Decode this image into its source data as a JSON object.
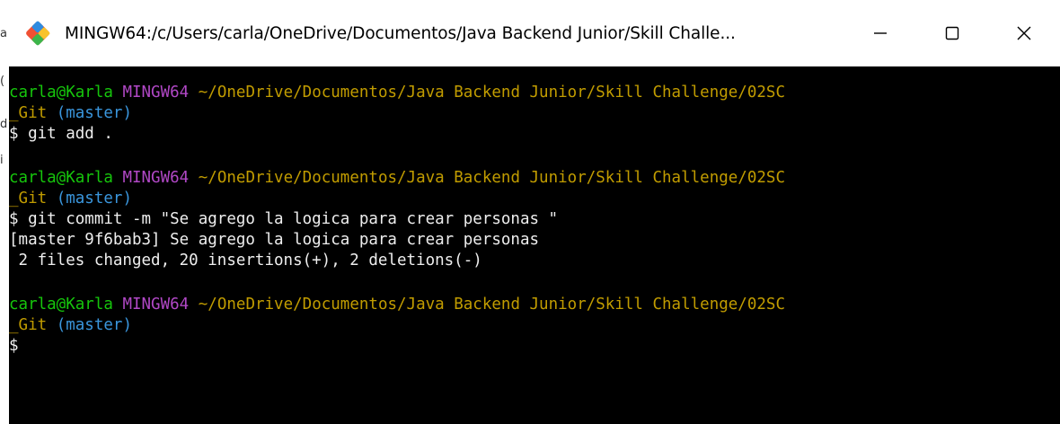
{
  "window": {
    "title": "MINGW64:/c/Users/carla/OneDrive/Documentos/Java Backend Junior/Skill Challe...",
    "icon": "git-bash-icon",
    "controls": {
      "minimize_icon": "minimize-icon",
      "maximize_icon": "maximize-icon",
      "close_icon": "close-icon"
    }
  },
  "behind_window": {
    "fragments": [
      "a",
      "(",
      "d",
      "i"
    ]
  },
  "colors": {
    "user_host": "#16c60c",
    "shell": "#b148c6",
    "path": "#c19c00",
    "branch": "#3a96dd",
    "text": "#eeeeee",
    "background": "#000000"
  },
  "terminal": {
    "blocks": [
      {
        "user": "carla@Karla",
        "shell": "MINGW64",
        "path_line1": "~/OneDrive/Documentos/Java Backend Junior/Skill Challenge/02SC",
        "path_line2": "_Git",
        "branch": "(master)",
        "command": "$ git add .",
        "output": []
      },
      {
        "user": "carla@Karla",
        "shell": "MINGW64",
        "path_line1": "~/OneDrive/Documentos/Java Backend Junior/Skill Challenge/02SC",
        "path_line2": "_Git",
        "branch": "(master)",
        "command": "$ git commit -m \"Se agrego la logica para crear personas \"",
        "output": [
          "[master 9f6bab3] Se agrego la logica para crear personas",
          " 2 files changed, 20 insertions(+), 2 deletions(-)"
        ]
      },
      {
        "user": "carla@Karla",
        "shell": "MINGW64",
        "path_line1": "~/OneDrive/Documentos/Java Backend Junior/Skill Challenge/02SC",
        "path_line2": "_Git",
        "branch": "(master)",
        "command": "$",
        "output": []
      }
    ]
  }
}
